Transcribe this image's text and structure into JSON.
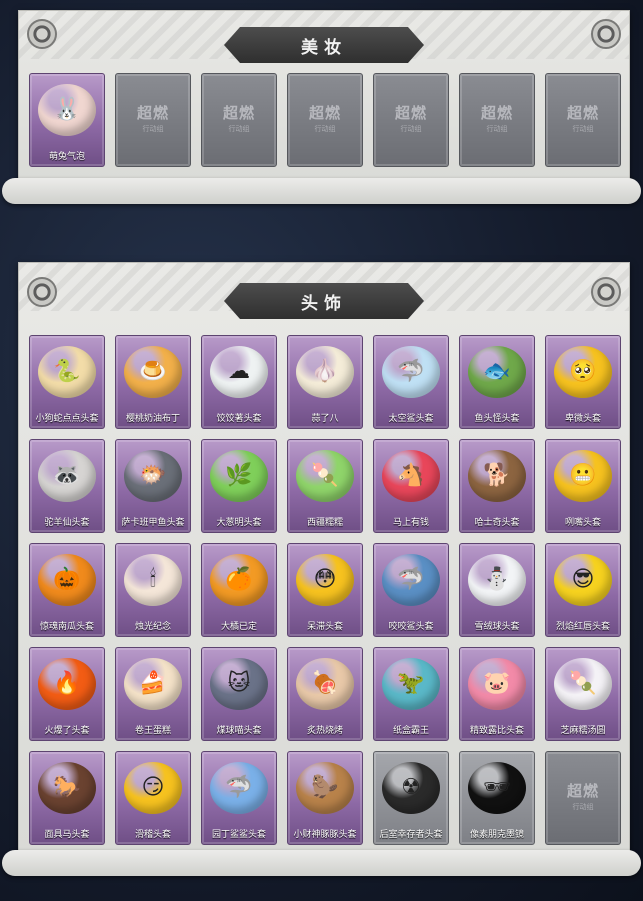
{
  "sections": {
    "makeup": {
      "title": "美妆",
      "items": [
        {
          "label": "萌兔气泡",
          "icon": "bunny-bubble-icon",
          "color": "#f0d6d0",
          "glyph": "🐰",
          "locked": false
        },
        {
          "label": "",
          "icon": "locked-placeholder-icon",
          "locked": true
        },
        {
          "label": "",
          "icon": "locked-placeholder-icon",
          "locked": true
        },
        {
          "label": "",
          "icon": "locked-placeholder-icon",
          "locked": true
        },
        {
          "label": "",
          "icon": "locked-placeholder-icon",
          "locked": true
        },
        {
          "label": "",
          "icon": "locked-placeholder-icon",
          "locked": true
        },
        {
          "label": "",
          "icon": "locked-placeholder-icon",
          "locked": true
        }
      ]
    },
    "headwear": {
      "title": "头饰",
      "items": [
        {
          "label": "小狗蛇点点头套",
          "icon": "dog-snake-head-icon",
          "color": "#f2dca8",
          "glyph": "🐍"
        },
        {
          "label": "樱桃奶油布丁",
          "icon": "cherry-pudding-icon",
          "color": "#f2b04a",
          "glyph": "🍮"
        },
        {
          "label": "饺饺著头套",
          "icon": "cloud-head-icon",
          "color": "#eef2f2",
          "glyph": "☁"
        },
        {
          "label": "蒜了八",
          "icon": "garlic-head-icon",
          "color": "#f4ecd8",
          "glyph": "🧄"
        },
        {
          "label": "太空鲨头套",
          "icon": "space-shark-head-icon",
          "color": "#bfe0f4",
          "glyph": "🦈"
        },
        {
          "label": "鱼头怪头套",
          "icon": "fish-monster-head-icon",
          "color": "#6fa84a",
          "glyph": "🐟"
        },
        {
          "label": "卑微头套",
          "icon": "humble-emoji-head-icon",
          "color": "#f6c21f",
          "glyph": "🥺"
        },
        {
          "label": "驼羊仙头套",
          "icon": "raccoon-head-icon",
          "color": "#d6d4d2",
          "glyph": "🦝"
        },
        {
          "label": "萨卡班甲鱼头套",
          "icon": "sacabambaspis-head-icon",
          "color": "#6a6f78",
          "glyph": "🐡"
        },
        {
          "label": "大葱明头套",
          "icon": "scallion-head-icon",
          "color": "#7fcf5a",
          "glyph": "🌿"
        },
        {
          "label": "西疆糯糯",
          "icon": "green-mochi-head-icon",
          "color": "#8fd46a",
          "glyph": "🍡"
        },
        {
          "label": "马上有钱",
          "icon": "red-horse-head-icon",
          "color": "#e8465a",
          "glyph": "🐴"
        },
        {
          "label": "哈士奇头套",
          "icon": "husky-head-icon",
          "color": "#8c6440",
          "glyph": "🐕"
        },
        {
          "label": "咧嘴头套",
          "icon": "grin-emoji-head-icon",
          "color": "#f6c21f",
          "glyph": "😬"
        },
        {
          "label": "惊魂南瓜头套",
          "icon": "pumpkin-head-icon",
          "color": "#f08a1c",
          "glyph": "🎃"
        },
        {
          "label": "烛光纪念",
          "icon": "candle-head-icon",
          "color": "#f4e6d8",
          "glyph": "🕯"
        },
        {
          "label": "大橘已定",
          "icon": "orange-head-icon",
          "color": "#f29a24",
          "glyph": "🍊"
        },
        {
          "label": "呆滞头套",
          "icon": "dazed-emoji-head-icon",
          "color": "#f6c21f",
          "glyph": "😳"
        },
        {
          "label": "咬咬鲨头套",
          "icon": "biting-shark-head-icon",
          "color": "#5a8fc4",
          "glyph": "🦈"
        },
        {
          "label": "雪绒球头套",
          "icon": "snowman-head-icon",
          "color": "#f2f4f6",
          "glyph": "⛄"
        },
        {
          "label": "烈焰红唇头套",
          "icon": "pikachu-sunglasses-head-icon",
          "color": "#f6d21f",
          "glyph": "😎"
        },
        {
          "label": "火爆了头套",
          "icon": "fire-head-icon",
          "color": "#f25c14",
          "glyph": "🔥"
        },
        {
          "label": "卷王蛋糕",
          "icon": "roll-cake-head-icon",
          "color": "#f4e2c8",
          "glyph": "🍰"
        },
        {
          "label": "煤球喵头套",
          "icon": "gray-cat-head-icon",
          "color": "#6a7288",
          "glyph": "🐱"
        },
        {
          "label": "炙热烧烤",
          "icon": "bbq-head-icon",
          "color": "#e8c8a8",
          "glyph": "🍖"
        },
        {
          "label": "纸盒霸王",
          "icon": "cardboard-dino-head-icon",
          "color": "#5ab8c8",
          "glyph": "🦖"
        },
        {
          "label": "精致露比头套",
          "icon": "pink-pig-head-icon",
          "color": "#f28aa8",
          "glyph": "🐷"
        },
        {
          "label": "芝麻糯汤圆",
          "icon": "tangyuan-head-icon",
          "color": "#f4f2f6",
          "glyph": "🍡"
        },
        {
          "label": "面具马头套",
          "icon": "horse-mask-head-icon",
          "color": "#6a4230",
          "glyph": "🐎"
        },
        {
          "label": "滑稽头套",
          "icon": "funny-emoji-head-icon",
          "color": "#f6c21f",
          "glyph": "😏"
        },
        {
          "label": "园丁鲨鲨头套",
          "icon": "gardener-shark-head-icon",
          "color": "#7ab0e8",
          "glyph": "🦈"
        },
        {
          "label": "小财神豚豚头套",
          "icon": "capybara-head-icon",
          "color": "#b8824a",
          "glyph": "🦫"
        },
        {
          "label": "后室幸存者头套",
          "icon": "gas-mask-head-icon",
          "color": "#2a2a2a",
          "glyph": "☢",
          "gray": true
        },
        {
          "label": "像素朋克墨镜",
          "icon": "pixel-sunglasses-icon",
          "color": "#111111",
          "glyph": "🕶",
          "gray": true
        },
        {
          "label": "",
          "icon": "locked-placeholder-icon",
          "locked": true
        }
      ]
    }
  },
  "locked_logo": "超燃",
  "locked_sub": "行动组"
}
